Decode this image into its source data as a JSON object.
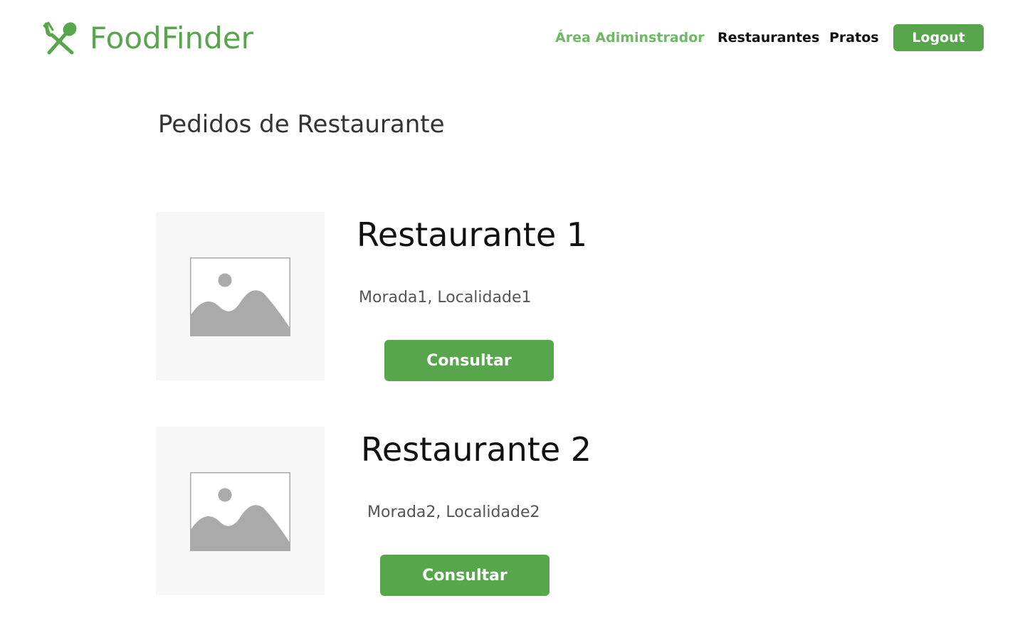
{
  "header": {
    "brand": "FoodFinder",
    "brand_icon": "fork-spoon-icon",
    "nav": {
      "admin": "Área Adiminstrador",
      "restaurants": "Restaurantes",
      "dishes": "Pratos"
    },
    "logout_label": "Logout"
  },
  "page": {
    "title": "Pedidos de Restaurante"
  },
  "restaurants": [
    {
      "name": "Restaurante 1",
      "address": "Morada1, Localidade1",
      "button_label": "Consultar",
      "image_icon": "image-placeholder-icon"
    },
    {
      "name": "Restaurante 2",
      "address": "Morada2, Localidade2",
      "button_label": "Consultar",
      "image_icon": "image-placeholder-icon"
    }
  ],
  "colors": {
    "brand_green": "#58a64b",
    "active_nav_green": "#6fb865",
    "placeholder_bg": "#f7f7f7",
    "placeholder_gray": "#aaaaaa"
  }
}
